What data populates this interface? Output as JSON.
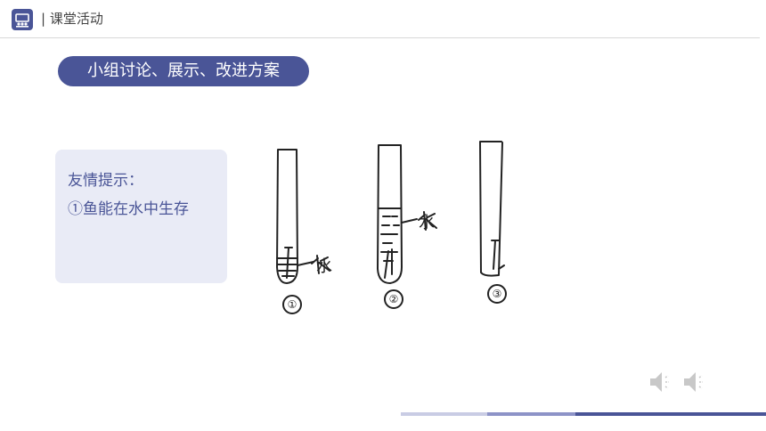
{
  "header": {
    "title": "| 课堂活动"
  },
  "section": {
    "title": "小组讨论、展示、改进方案"
  },
  "tip": {
    "heading": "友情提示：",
    "line1": "①鱼能在水中生存"
  },
  "tubes": [
    {
      "number": "①",
      "label": "水"
    },
    {
      "number": "②",
      "label": "水"
    },
    {
      "number": "③"
    }
  ],
  "audio": {
    "icons": [
      "speaker-icon",
      "speaker-icon"
    ]
  },
  "colors": {
    "accent": "#4a5597",
    "tip_bg": "#e9ebf6"
  }
}
